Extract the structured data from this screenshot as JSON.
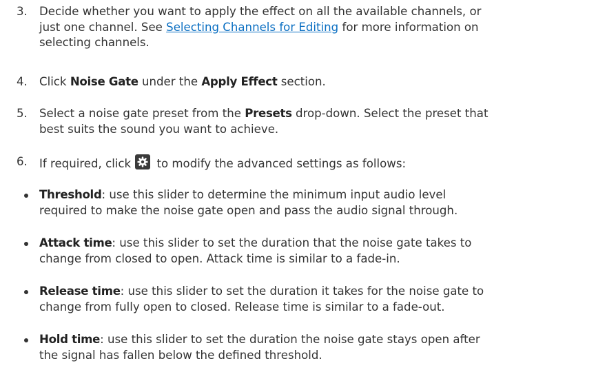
{
  "steps": [
    {
      "number": "3.",
      "line1_a": "Decide whether you want to apply the effect on all the available channels, or",
      "line2_a": "just one channel. See ",
      "line2_link": "Selecting Channels for Editing",
      "line2_b": " for more information on",
      "line3": "selecting channels."
    },
    {
      "number": "4.",
      "a": "Click ",
      "b": "Noise Gate",
      "c": " under the ",
      "d": "Apply Effect",
      "e": " section."
    },
    {
      "number": "5.",
      "a": "Select a noise gate preset from the ",
      "b": "Presets",
      "c": " drop-down. Select the preset that",
      "line2": "best suits the sound you want to achieve."
    },
    {
      "number": "6.",
      "a": "If required, click",
      "b": " to modify the advanced settings as follows:",
      "icon": "gear-icon"
    }
  ],
  "bullets": [
    {
      "term": "Threshold",
      "line1": ": use this slider to determine the minimum input audio level",
      "line2": "required to make the noise gate open and pass the audio signal through."
    },
    {
      "term": "Attack time",
      "line1": ": use this slider to set the duration that the noise gate takes to",
      "line2": "change from closed to open. Attack time is similar to a fade-in."
    },
    {
      "term": "Release time",
      "line1": ": use this slider to set the duration it takes for the noise gate to",
      "line2": "change from fully open to closed. Release time is similar to a fade-out."
    },
    {
      "term": "Hold time",
      "line1": ": use this slider to set the duration the noise gate stays open after",
      "line2": "the signal has fallen below the defined threshold."
    }
  ]
}
